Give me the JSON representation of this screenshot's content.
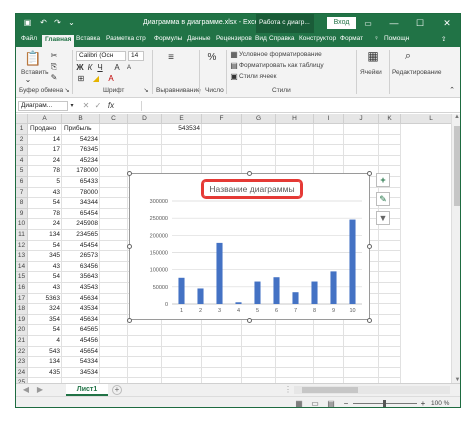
{
  "titlebar": {
    "autosave_icon": "save-icon",
    "undo_icon": "undo-icon",
    "redo_icon": "redo-icon",
    "customize_icon": "more-icon",
    "title": "Диаграмма в диаграмме.xlsx - Excel",
    "context_tab": "Работа с диагр...",
    "signin": "Вход",
    "ribbon_display_icon": "ribbon-display-icon",
    "minimize": "—",
    "maximize": "☐",
    "close": "✕"
  },
  "tabs": [
    "Файл",
    "Главная",
    "Вставка",
    "Разметка стр",
    "Формулы",
    "Данные",
    "Рецензиров",
    "Вид",
    "Справка",
    "Конструктор",
    "Формат"
  ],
  "tabs_right": {
    "help_label": "Помощн",
    "share_icon": "share-icon"
  },
  "ribbon": {
    "paste_label": "Вставить",
    "clipboard_label": "Буфер обмена",
    "font_name": "Calibri (Осн",
    "font_size": "14",
    "font_label": "Шрифт",
    "bold": "Ж",
    "italic": "К",
    "underline": "Ч",
    "align_label": "Выравнивание",
    "number_label": "Число",
    "cond_format": "Условное форматирование",
    "format_table": "Форматировать как таблицу",
    "cell_styles": "Стили ячеек",
    "styles_label": "Стили",
    "cells_label": "Ячейки",
    "editing_label": "Редактирование"
  },
  "formula_bar": {
    "name_box": "Диаграм...",
    "fx": "fx",
    "formula": ""
  },
  "sheet": {
    "columns": [
      "A",
      "B",
      "C",
      "D",
      "E",
      "F",
      "G",
      "H",
      "I",
      "J",
      "K",
      "L"
    ],
    "rows": [
      [
        "Продано",
        "Прибыль",
        "",
        "",
        "543534"
      ],
      [
        "14",
        "54234"
      ],
      [
        "17",
        "76345"
      ],
      [
        "24",
        "45234"
      ],
      [
        "78",
        "178000"
      ],
      [
        "5",
        "65433"
      ],
      [
        "43",
        "78000"
      ],
      [
        "54",
        "34344"
      ],
      [
        "78",
        "65454"
      ],
      [
        "24",
        "245908"
      ],
      [
        "134",
        "234565"
      ],
      [
        "54",
        "45454"
      ],
      [
        "345",
        "26573"
      ],
      [
        "43",
        "63456"
      ],
      [
        "54",
        "35643"
      ],
      [
        "43",
        "43543"
      ],
      [
        "5363",
        "45634"
      ],
      [
        "324",
        "43534"
      ],
      [
        "354",
        "45634"
      ],
      [
        "54",
        "64565"
      ],
      [
        "4",
        "45456"
      ],
      [
        "543",
        "45654"
      ],
      [
        "134",
        "54334"
      ],
      [
        "435",
        "34534"
      ]
    ]
  },
  "chart_data": {
    "type": "bar",
    "title": "Название диаграммы",
    "categories": [
      "1",
      "2",
      "3",
      "4",
      "5",
      "6",
      "7",
      "8",
      "9",
      "10"
    ],
    "values": [
      76345,
      45234,
      178000,
      5000,
      65433,
      78000,
      34344,
      65454,
      95000,
      245908
    ],
    "ylim": [
      0,
      300000
    ],
    "yticks": [
      "300000",
      "250000",
      "200000",
      "150000",
      "100000",
      "50000",
      "0"
    ],
    "grid": true,
    "legend": "none",
    "bar_color": "#4472c4"
  },
  "chart_buttons": {
    "add_icon": "plus-icon",
    "style_icon": "brush-icon",
    "filter_icon": "filter-icon"
  },
  "sheet_tabs": {
    "active": "Лист1",
    "add_icon": "plus-icon",
    "prev_icon": "chevron-left-icon",
    "next_icon": "chevron-right-icon"
  },
  "status": {
    "zoom": "100 %",
    "zoom_out": "−",
    "zoom_in": "+"
  },
  "colors": {
    "excel_green": "#217346",
    "selection_red": "#e53935"
  }
}
